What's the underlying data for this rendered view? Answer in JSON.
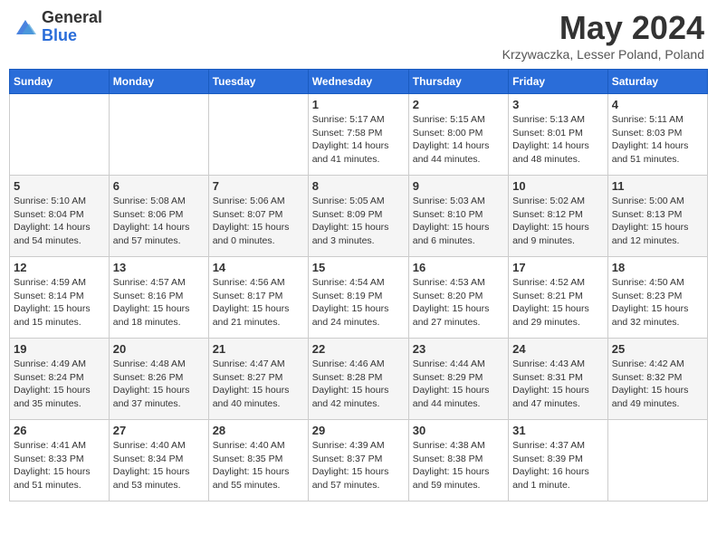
{
  "header": {
    "logo_general": "General",
    "logo_blue": "Blue",
    "month_title": "May 2024",
    "location": "Krzywaczka, Lesser Poland, Poland"
  },
  "days_of_week": [
    "Sunday",
    "Monday",
    "Tuesday",
    "Wednesday",
    "Thursday",
    "Friday",
    "Saturday"
  ],
  "weeks": [
    [
      {
        "day": "",
        "info": ""
      },
      {
        "day": "",
        "info": ""
      },
      {
        "day": "",
        "info": ""
      },
      {
        "day": "1",
        "info": "Sunrise: 5:17 AM\nSunset: 7:58 PM\nDaylight: 14 hours and 41 minutes."
      },
      {
        "day": "2",
        "info": "Sunrise: 5:15 AM\nSunset: 8:00 PM\nDaylight: 14 hours and 44 minutes."
      },
      {
        "day": "3",
        "info": "Sunrise: 5:13 AM\nSunset: 8:01 PM\nDaylight: 14 hours and 48 minutes."
      },
      {
        "day": "4",
        "info": "Sunrise: 5:11 AM\nSunset: 8:03 PM\nDaylight: 14 hours and 51 minutes."
      }
    ],
    [
      {
        "day": "5",
        "info": "Sunrise: 5:10 AM\nSunset: 8:04 PM\nDaylight: 14 hours and 54 minutes."
      },
      {
        "day": "6",
        "info": "Sunrise: 5:08 AM\nSunset: 8:06 PM\nDaylight: 14 hours and 57 minutes."
      },
      {
        "day": "7",
        "info": "Sunrise: 5:06 AM\nSunset: 8:07 PM\nDaylight: 15 hours and 0 minutes."
      },
      {
        "day": "8",
        "info": "Sunrise: 5:05 AM\nSunset: 8:09 PM\nDaylight: 15 hours and 3 minutes."
      },
      {
        "day": "9",
        "info": "Sunrise: 5:03 AM\nSunset: 8:10 PM\nDaylight: 15 hours and 6 minutes."
      },
      {
        "day": "10",
        "info": "Sunrise: 5:02 AM\nSunset: 8:12 PM\nDaylight: 15 hours and 9 minutes."
      },
      {
        "day": "11",
        "info": "Sunrise: 5:00 AM\nSunset: 8:13 PM\nDaylight: 15 hours and 12 minutes."
      }
    ],
    [
      {
        "day": "12",
        "info": "Sunrise: 4:59 AM\nSunset: 8:14 PM\nDaylight: 15 hours and 15 minutes."
      },
      {
        "day": "13",
        "info": "Sunrise: 4:57 AM\nSunset: 8:16 PM\nDaylight: 15 hours and 18 minutes."
      },
      {
        "day": "14",
        "info": "Sunrise: 4:56 AM\nSunset: 8:17 PM\nDaylight: 15 hours and 21 minutes."
      },
      {
        "day": "15",
        "info": "Sunrise: 4:54 AM\nSunset: 8:19 PM\nDaylight: 15 hours and 24 minutes."
      },
      {
        "day": "16",
        "info": "Sunrise: 4:53 AM\nSunset: 8:20 PM\nDaylight: 15 hours and 27 minutes."
      },
      {
        "day": "17",
        "info": "Sunrise: 4:52 AM\nSunset: 8:21 PM\nDaylight: 15 hours and 29 minutes."
      },
      {
        "day": "18",
        "info": "Sunrise: 4:50 AM\nSunset: 8:23 PM\nDaylight: 15 hours and 32 minutes."
      }
    ],
    [
      {
        "day": "19",
        "info": "Sunrise: 4:49 AM\nSunset: 8:24 PM\nDaylight: 15 hours and 35 minutes."
      },
      {
        "day": "20",
        "info": "Sunrise: 4:48 AM\nSunset: 8:26 PM\nDaylight: 15 hours and 37 minutes."
      },
      {
        "day": "21",
        "info": "Sunrise: 4:47 AM\nSunset: 8:27 PM\nDaylight: 15 hours and 40 minutes."
      },
      {
        "day": "22",
        "info": "Sunrise: 4:46 AM\nSunset: 8:28 PM\nDaylight: 15 hours and 42 minutes."
      },
      {
        "day": "23",
        "info": "Sunrise: 4:44 AM\nSunset: 8:29 PM\nDaylight: 15 hours and 44 minutes."
      },
      {
        "day": "24",
        "info": "Sunrise: 4:43 AM\nSunset: 8:31 PM\nDaylight: 15 hours and 47 minutes."
      },
      {
        "day": "25",
        "info": "Sunrise: 4:42 AM\nSunset: 8:32 PM\nDaylight: 15 hours and 49 minutes."
      }
    ],
    [
      {
        "day": "26",
        "info": "Sunrise: 4:41 AM\nSunset: 8:33 PM\nDaylight: 15 hours and 51 minutes."
      },
      {
        "day": "27",
        "info": "Sunrise: 4:40 AM\nSunset: 8:34 PM\nDaylight: 15 hours and 53 minutes."
      },
      {
        "day": "28",
        "info": "Sunrise: 4:40 AM\nSunset: 8:35 PM\nDaylight: 15 hours and 55 minutes."
      },
      {
        "day": "29",
        "info": "Sunrise: 4:39 AM\nSunset: 8:37 PM\nDaylight: 15 hours and 57 minutes."
      },
      {
        "day": "30",
        "info": "Sunrise: 4:38 AM\nSunset: 8:38 PM\nDaylight: 15 hours and 59 minutes."
      },
      {
        "day": "31",
        "info": "Sunrise: 4:37 AM\nSunset: 8:39 PM\nDaylight: 16 hours and 1 minute."
      },
      {
        "day": "",
        "info": ""
      }
    ]
  ]
}
